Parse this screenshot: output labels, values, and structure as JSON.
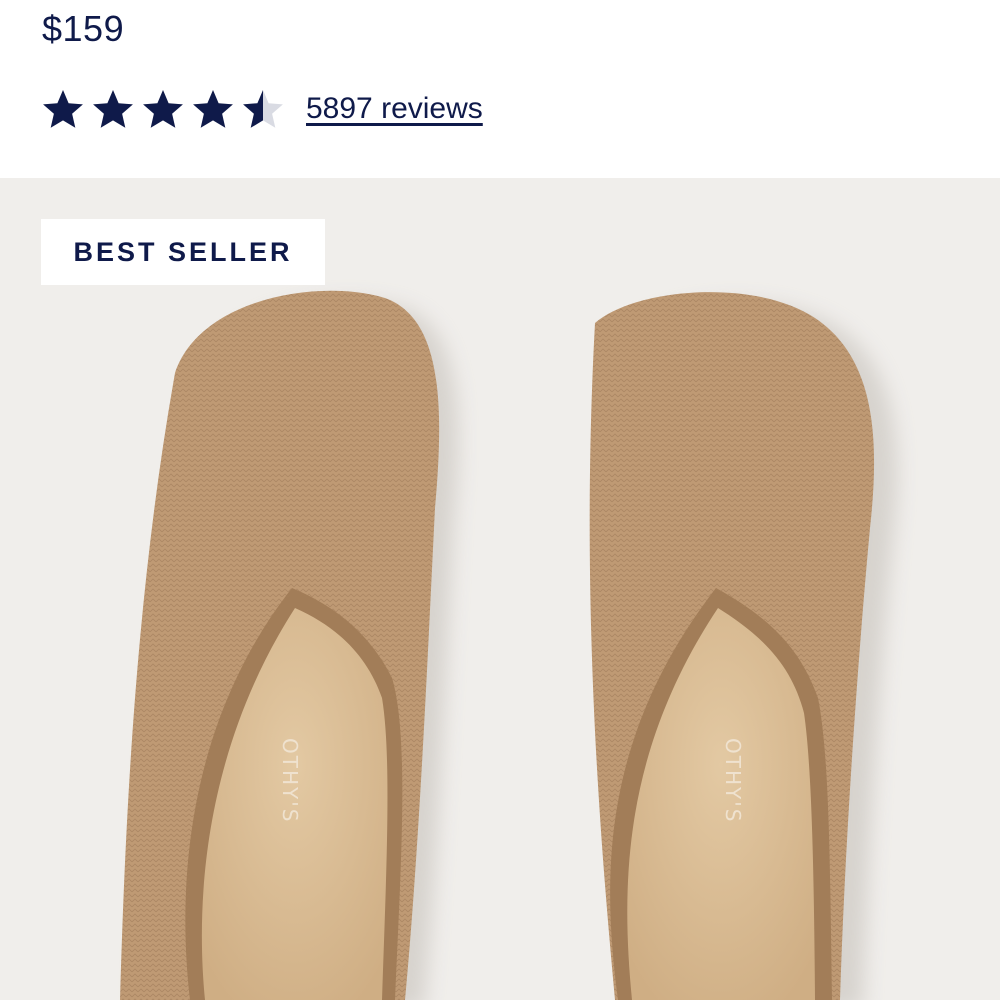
{
  "product": {
    "price": "$159",
    "rating": {
      "value": 4.5,
      "max": 5,
      "reviews_label": "5897 reviews"
    },
    "badge": "BEST SELLER",
    "insole_brand_left": "OTHY'S",
    "insole_brand_right": "OTHY'S"
  },
  "colors": {
    "text": "#0f1a4a",
    "star_filled": "#0f1a4a",
    "star_empty": "#d9dbe3",
    "image_background": "#f0eeeb",
    "slipper_upper": "#bf9a74",
    "slipper_insole": "#d9bd95"
  },
  "icons": [
    "star-icon"
  ]
}
